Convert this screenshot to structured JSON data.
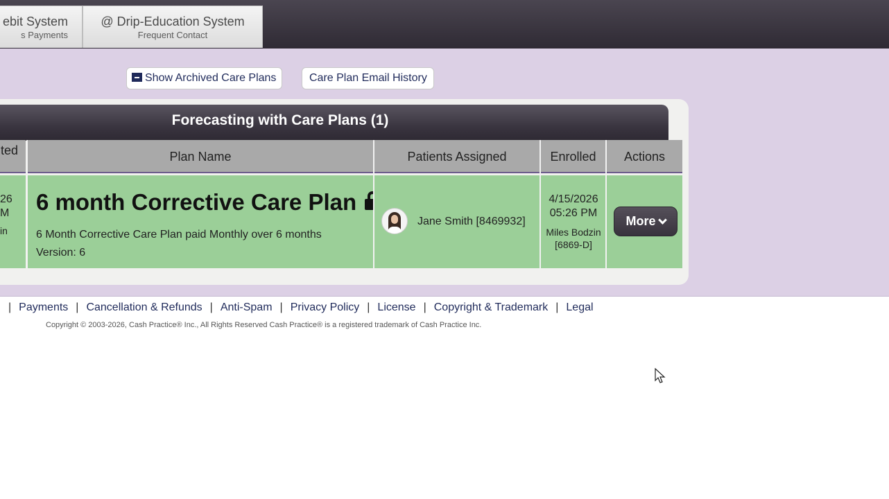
{
  "nav": {
    "tabs": [
      {
        "title": "ebit System",
        "subtitle": "s Payments"
      },
      {
        "title": "@ Drip-Education System",
        "subtitle": "Frequent Contact"
      }
    ]
  },
  "toolbar": {
    "archive_label": "Show Archived Care Plans",
    "history_label": "Care Plan Email History"
  },
  "panel": {
    "title": "Forecasting with Care Plans (1)",
    "columns": {
      "created_partial": "ted",
      "plan_name": "Plan Name",
      "patients": "Patients Assigned",
      "enrolled": "Enrolled",
      "actions": "Actions"
    },
    "row": {
      "created_partial_1": "26",
      "created_partial_2": "M",
      "created_partial_3": "in",
      "plan_name": "6 month Corrective Care Plan",
      "description": "6 Month Corrective Care Plan paid Monthly over 6 months",
      "version": "Version: 6",
      "patient": "Jane Smith [8469932]",
      "enrolled_date": "4/15/2026",
      "enrolled_time": "05:26 PM",
      "enrolled_by": "Miles Bodzin",
      "enrolled_by_id": "[6869-D]",
      "action_label": "More"
    }
  },
  "footer": {
    "links": [
      "Payments",
      "Cancellation & Refunds",
      "Anti-Spam",
      "Privacy Policy",
      "License",
      "Copyright & Trademark",
      "Legal"
    ],
    "separator": "|",
    "copyright": "Copyright © 2003-2026, Cash Practice® Inc., All Rights Reserved Cash Practice® is a registered trademark of Cash Practice Inc."
  }
}
